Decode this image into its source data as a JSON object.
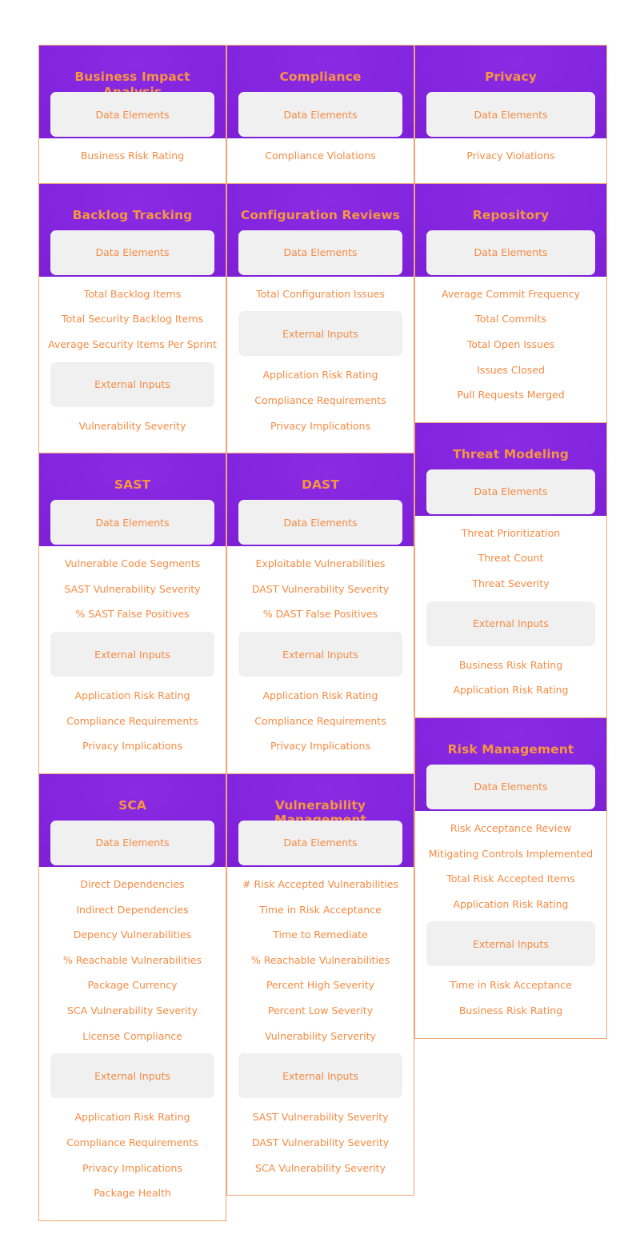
{
  "theme": {
    "header_purple": "#8a2be2",
    "header_purple_dark": "#7419c6",
    "accent_orange": "#f79541",
    "text_orange": "#f58b43",
    "chip_grey": "#f0f0f0",
    "border_orange": "#f0a573",
    "page_background": "#ffffff"
  },
  "labels": {
    "data_elements": "Data Elements",
    "external_inputs": "External Inputs"
  },
  "columns": [
    {
      "name": "column-1",
      "cards": [
        {
          "title": "Business Impact Analysis",
          "sections": [
            {
              "chip": "Data Elements",
              "items": [
                "Business Risk Rating"
              ]
            }
          ]
        },
        {
          "title": "Backlog Tracking",
          "sections": [
            {
              "chip": "Data Elements",
              "items": [
                "Total Backlog Items",
                "Total Security Backlog Items",
                "Average Security Items Per Sprint"
              ]
            },
            {
              "chip": "External Inputs",
              "items": [
                "Vulnerability Severity"
              ]
            }
          ]
        },
        {
          "title": "SAST",
          "sections": [
            {
              "chip": "Data Elements",
              "items": [
                "Vulnerable Code Segments",
                "SAST Vulnerability Severity",
                "% SAST False Positives"
              ]
            },
            {
              "chip": "External Inputs",
              "items": [
                "Application Risk Rating",
                "Compliance Requirements",
                "Privacy Implications"
              ]
            }
          ]
        },
        {
          "title": "SCA",
          "sections": [
            {
              "chip": "Data Elements",
              "items": [
                "Direct Dependencies",
                "Indirect Dependencies",
                "Depency Vulnerabilities",
                "% Reachable Vulnerabilities",
                "Package Currency",
                "SCA Vulnerability Severity",
                "License Compliance"
              ]
            },
            {
              "chip": "External Inputs",
              "items": [
                "Application Risk Rating",
                "Compliance Requirements",
                "Privacy Implications",
                "Package Health"
              ]
            }
          ]
        }
      ]
    },
    {
      "name": "column-2",
      "cards": [
        {
          "title": "Compliance",
          "sections": [
            {
              "chip": "Data Elements",
              "items": [
                "Compliance Violations"
              ]
            }
          ]
        },
        {
          "title": "Configuration Reviews",
          "sections": [
            {
              "chip": "Data Elements",
              "items": [
                "Total Configuration Issues"
              ]
            },
            {
              "chip": "External Inputs",
              "items": [
                "Application Risk Rating",
                "Compliance Requirements",
                "Privacy Implications"
              ]
            }
          ]
        },
        {
          "title": "DAST",
          "sections": [
            {
              "chip": "Data Elements",
              "items": [
                "Exploitable Vulnerabilities",
                "DAST Vulnerability Severity",
                "% DAST False Positives"
              ]
            },
            {
              "chip": "External Inputs",
              "items": [
                "Application Risk Rating",
                "Compliance Requirements",
                "Privacy Implications"
              ]
            }
          ]
        },
        {
          "title": "Vulnerability Management",
          "sections": [
            {
              "chip": "Data Elements",
              "items": [
                "# Risk Accepted Vulnerabilities",
                "Time in Risk Acceptance",
                "Time to Remediate",
                "% Reachable Vulnerabilities",
                "Percent High Severity",
                "Percent Low Severity",
                "Vulnerability Serverity"
              ]
            },
            {
              "chip": "External Inputs",
              "items": [
                "SAST Vulnerability Severity",
                "DAST Vulnerability Severity",
                "SCA Vulnerability Severity"
              ]
            }
          ]
        }
      ]
    },
    {
      "name": "column-3",
      "cards": [
        {
          "title": "Privacy",
          "sections": [
            {
              "chip": "Data Elements",
              "items": [
                "Privacy Violations"
              ]
            }
          ]
        },
        {
          "title": "Repository",
          "sections": [
            {
              "chip": "Data Elements",
              "items": [
                "Average Commit Frequency",
                "Total Commits",
                "Total Open Issues",
                "Issues Closed",
                "Pull Requests Merged"
              ]
            }
          ]
        },
        {
          "title": "Threat Modeling",
          "sections": [
            {
              "chip": "Data Elements",
              "items": [
                "Threat Prioritization",
                "Threat Count",
                "Threat Severity"
              ]
            },
            {
              "chip": "External Inputs",
              "items": [
                "Business Risk Rating",
                "Application Risk Rating"
              ]
            }
          ]
        },
        {
          "title": "Risk Management",
          "sections": [
            {
              "chip": "Data Elements",
              "items": [
                "Risk Acceptance Review",
                "Mitigating Controls Implemented",
                "Total Risk Accepted Items",
                "Application Risk Rating"
              ]
            },
            {
              "chip": "External Inputs",
              "items": [
                "Time in Risk Acceptance",
                "Business Risk Rating"
              ]
            }
          ]
        }
      ]
    }
  ]
}
